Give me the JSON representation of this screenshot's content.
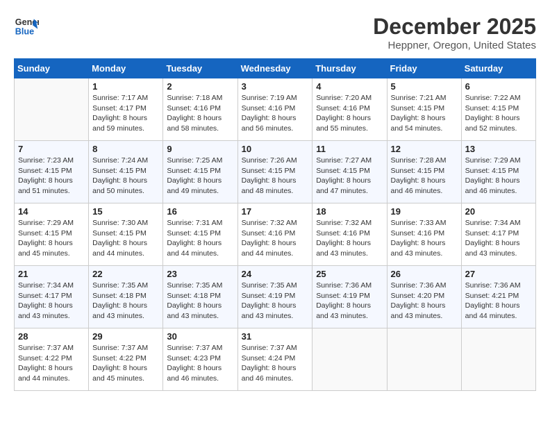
{
  "header": {
    "logo_line1": "General",
    "logo_line2": "Blue",
    "month": "December 2025",
    "location": "Heppner, Oregon, United States"
  },
  "weekdays": [
    "Sunday",
    "Monday",
    "Tuesday",
    "Wednesday",
    "Thursday",
    "Friday",
    "Saturday"
  ],
  "weeks": [
    [
      {
        "day": "",
        "info": ""
      },
      {
        "day": "1",
        "info": "Sunrise: 7:17 AM\nSunset: 4:17 PM\nDaylight: 8 hours\nand 59 minutes."
      },
      {
        "day": "2",
        "info": "Sunrise: 7:18 AM\nSunset: 4:16 PM\nDaylight: 8 hours\nand 58 minutes."
      },
      {
        "day": "3",
        "info": "Sunrise: 7:19 AM\nSunset: 4:16 PM\nDaylight: 8 hours\nand 56 minutes."
      },
      {
        "day": "4",
        "info": "Sunrise: 7:20 AM\nSunset: 4:16 PM\nDaylight: 8 hours\nand 55 minutes."
      },
      {
        "day": "5",
        "info": "Sunrise: 7:21 AM\nSunset: 4:15 PM\nDaylight: 8 hours\nand 54 minutes."
      },
      {
        "day": "6",
        "info": "Sunrise: 7:22 AM\nSunset: 4:15 PM\nDaylight: 8 hours\nand 52 minutes."
      }
    ],
    [
      {
        "day": "7",
        "info": "Sunrise: 7:23 AM\nSunset: 4:15 PM\nDaylight: 8 hours\nand 51 minutes."
      },
      {
        "day": "8",
        "info": "Sunrise: 7:24 AM\nSunset: 4:15 PM\nDaylight: 8 hours\nand 50 minutes."
      },
      {
        "day": "9",
        "info": "Sunrise: 7:25 AM\nSunset: 4:15 PM\nDaylight: 8 hours\nand 49 minutes."
      },
      {
        "day": "10",
        "info": "Sunrise: 7:26 AM\nSunset: 4:15 PM\nDaylight: 8 hours\nand 48 minutes."
      },
      {
        "day": "11",
        "info": "Sunrise: 7:27 AM\nSunset: 4:15 PM\nDaylight: 8 hours\nand 47 minutes."
      },
      {
        "day": "12",
        "info": "Sunrise: 7:28 AM\nSunset: 4:15 PM\nDaylight: 8 hours\nand 46 minutes."
      },
      {
        "day": "13",
        "info": "Sunrise: 7:29 AM\nSunset: 4:15 PM\nDaylight: 8 hours\nand 46 minutes."
      }
    ],
    [
      {
        "day": "14",
        "info": "Sunrise: 7:29 AM\nSunset: 4:15 PM\nDaylight: 8 hours\nand 45 minutes."
      },
      {
        "day": "15",
        "info": "Sunrise: 7:30 AM\nSunset: 4:15 PM\nDaylight: 8 hours\nand 44 minutes."
      },
      {
        "day": "16",
        "info": "Sunrise: 7:31 AM\nSunset: 4:15 PM\nDaylight: 8 hours\nand 44 minutes."
      },
      {
        "day": "17",
        "info": "Sunrise: 7:32 AM\nSunset: 4:16 PM\nDaylight: 8 hours\nand 44 minutes."
      },
      {
        "day": "18",
        "info": "Sunrise: 7:32 AM\nSunset: 4:16 PM\nDaylight: 8 hours\nand 43 minutes."
      },
      {
        "day": "19",
        "info": "Sunrise: 7:33 AM\nSunset: 4:16 PM\nDaylight: 8 hours\nand 43 minutes."
      },
      {
        "day": "20",
        "info": "Sunrise: 7:34 AM\nSunset: 4:17 PM\nDaylight: 8 hours\nand 43 minutes."
      }
    ],
    [
      {
        "day": "21",
        "info": "Sunrise: 7:34 AM\nSunset: 4:17 PM\nDaylight: 8 hours\nand 43 minutes."
      },
      {
        "day": "22",
        "info": "Sunrise: 7:35 AM\nSunset: 4:18 PM\nDaylight: 8 hours\nand 43 minutes."
      },
      {
        "day": "23",
        "info": "Sunrise: 7:35 AM\nSunset: 4:18 PM\nDaylight: 8 hours\nand 43 minutes."
      },
      {
        "day": "24",
        "info": "Sunrise: 7:35 AM\nSunset: 4:19 PM\nDaylight: 8 hours\nand 43 minutes."
      },
      {
        "day": "25",
        "info": "Sunrise: 7:36 AM\nSunset: 4:19 PM\nDaylight: 8 hours\nand 43 minutes."
      },
      {
        "day": "26",
        "info": "Sunrise: 7:36 AM\nSunset: 4:20 PM\nDaylight: 8 hours\nand 43 minutes."
      },
      {
        "day": "27",
        "info": "Sunrise: 7:36 AM\nSunset: 4:21 PM\nDaylight: 8 hours\nand 44 minutes."
      }
    ],
    [
      {
        "day": "28",
        "info": "Sunrise: 7:37 AM\nSunset: 4:22 PM\nDaylight: 8 hours\nand 44 minutes."
      },
      {
        "day": "29",
        "info": "Sunrise: 7:37 AM\nSunset: 4:22 PM\nDaylight: 8 hours\nand 45 minutes."
      },
      {
        "day": "30",
        "info": "Sunrise: 7:37 AM\nSunset: 4:23 PM\nDaylight: 8 hours\nand 46 minutes."
      },
      {
        "day": "31",
        "info": "Sunrise: 7:37 AM\nSunset: 4:24 PM\nDaylight: 8 hours\nand 46 minutes."
      },
      {
        "day": "",
        "info": ""
      },
      {
        "day": "",
        "info": ""
      },
      {
        "day": "",
        "info": ""
      }
    ]
  ]
}
